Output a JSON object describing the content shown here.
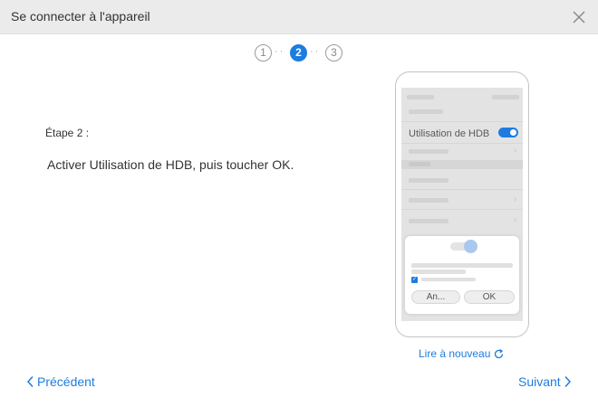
{
  "window": {
    "title": "Se connecter à l'appareil"
  },
  "steps": [
    {
      "label": "1"
    },
    {
      "label": "2"
    },
    {
      "label": "3"
    }
  ],
  "active_step": "2",
  "content": {
    "step_label": "Étape 2 :",
    "instruction": "Activer Utilisation de HDB, puis toucher OK."
  },
  "phone": {
    "setting_label": "Utilisation de HDB",
    "setting_enabled": true,
    "dialog": {
      "cancel_label": "An...",
      "ok_label": "OK",
      "checkbox_checked": true
    }
  },
  "replay_label": "Lire à nouveau",
  "nav": {
    "prev_label": "Précédent",
    "next_label": "Suivant"
  },
  "colors": {
    "accent": "#1e7ce0",
    "titlebar": "#ebebeb"
  },
  "icons": {
    "close": "close-icon",
    "replay": "refresh-icon",
    "prev": "chevron-left-icon",
    "next": "chevron-right-icon"
  }
}
